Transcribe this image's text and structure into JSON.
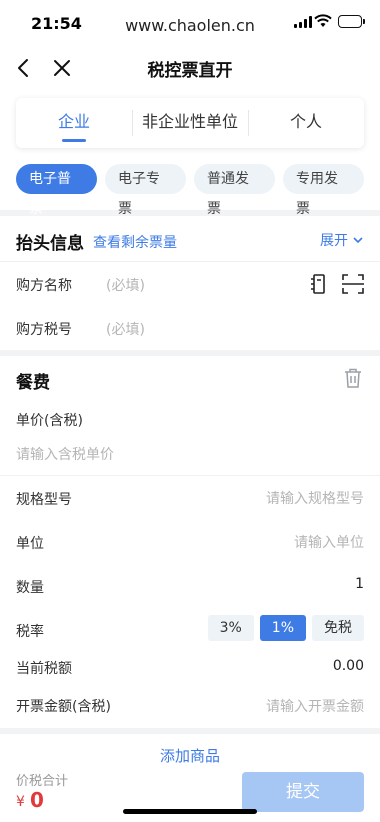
{
  "status_bar": {
    "time": "21:54",
    "url": "www.chaolen.cn"
  },
  "nav": {
    "title": "税控票直开"
  },
  "buyer_tabs": [
    {
      "label": "企业",
      "active": true
    },
    {
      "label": "非企业性单位",
      "active": false
    },
    {
      "label": "个人",
      "active": false
    }
  ],
  "invoice_types": [
    {
      "label": "电子普票",
      "active": true
    },
    {
      "label": "电子专票",
      "active": false
    },
    {
      "label": "普通发票",
      "active": false
    },
    {
      "label": "专用发票",
      "active": false
    }
  ],
  "header_section": {
    "title": "抬头信息",
    "remaining_link": "查看剩余票量",
    "expand_label": "展开",
    "buyer_name": {
      "label": "购方名称",
      "placeholder": "(必填)"
    },
    "buyer_tax_no": {
      "label": "购方税号",
      "placeholder": "(必填)"
    }
  },
  "item": {
    "title": "餐费",
    "unit_price": {
      "label": "单价(含税)",
      "placeholder": "请输入含税单价"
    },
    "spec": {
      "label": "规格型号",
      "placeholder": "请输入规格型号"
    },
    "unit": {
      "label": "单位",
      "placeholder": "请输入单位"
    },
    "quantity": {
      "label": "数量",
      "value": "1"
    },
    "tax_rate": {
      "label": "税率",
      "options": [
        "3%",
        "1%",
        "免税"
      ],
      "selected": "1%"
    },
    "current_tax": {
      "label": "当前税额",
      "value": "0.00"
    },
    "amount": {
      "label": "开票金额(含税)",
      "placeholder": "请输入开票金额"
    }
  },
  "add_item_label": "添加商品",
  "footer": {
    "total_label": "价税合计",
    "currency": "¥",
    "total": "0",
    "submit_label": "提交"
  },
  "colors": {
    "accent": "#3e7be5",
    "total_red": "#e03a3a",
    "submit_disabled": "#a6c7f4"
  }
}
